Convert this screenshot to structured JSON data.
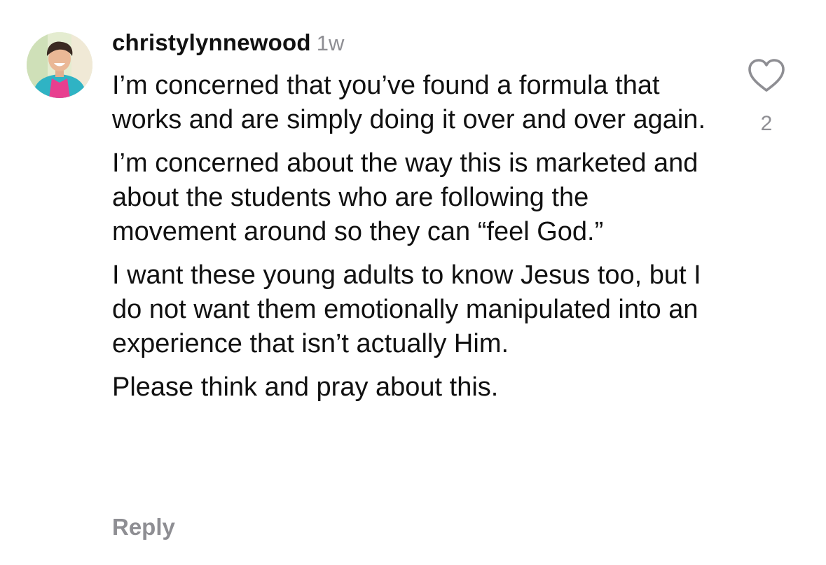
{
  "comment": {
    "username": "christylynnewood",
    "timestamp": "1w",
    "paragraphs": [
      "I’m concerned that you’ve found a formula that works and are simply doing it over and over again.",
      "I’m concerned about the way this is marketed and about the students who are following the movement around so they can “feel God.”",
      "I want these young adults to know Jesus too, but I do not want them emotionally manipulated into an experience that isn’t actually Him.",
      "Please think and pray about this."
    ],
    "reply_label": "Reply",
    "like_count": "2"
  },
  "icons": {
    "like": "heart-outline-icon",
    "avatar": "profile-photo"
  },
  "colors": {
    "text": "#111111",
    "secondary_text": "#8e8e93",
    "background": "#ffffff"
  }
}
